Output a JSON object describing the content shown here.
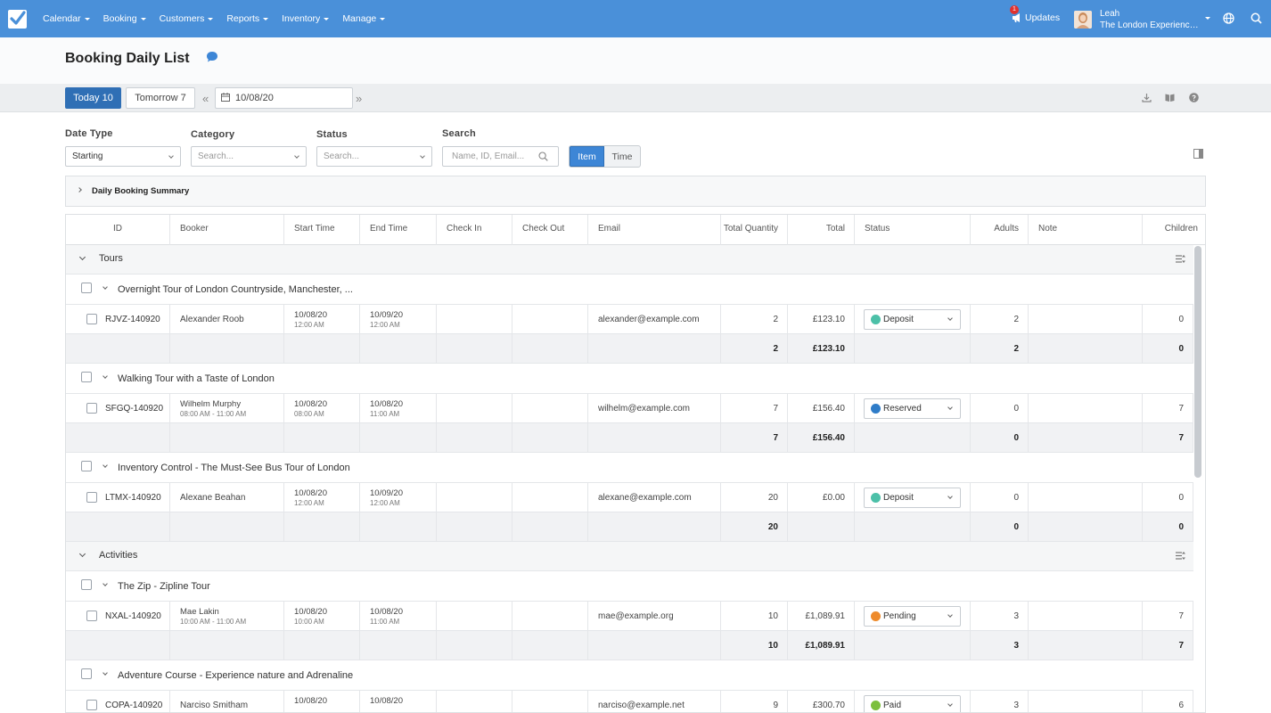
{
  "nav": {
    "items": [
      {
        "label": "Calendar"
      },
      {
        "label": "Booking"
      },
      {
        "label": "Customers"
      },
      {
        "label": "Reports"
      },
      {
        "label": "Inventory"
      },
      {
        "label": "Manage"
      }
    ],
    "updates_label": "Updates",
    "updates_count": "1",
    "user_name": "Leah",
    "user_company": "The London Experience..."
  },
  "page": {
    "title": "Booking Daily List"
  },
  "datebar": {
    "today_label": "Today 10",
    "tomorrow_label": "Tomorrow 7",
    "date_value": "10/08/20"
  },
  "filters": {
    "date_type_label": "Date Type",
    "date_type_value": "Starting",
    "category_label": "Category",
    "category_placeholder": "Search...",
    "status_label": "Status",
    "status_placeholder": "Search...",
    "search_label": "Search",
    "search_placeholder": "Name, ID, Email...",
    "view_item": "Item",
    "view_time": "Time"
  },
  "summary": {
    "label": "Daily Booking Summary"
  },
  "table": {
    "headers": [
      "ID",
      "Booker",
      "Start Time",
      "End Time",
      "Check In",
      "Check Out",
      "Email",
      "Total Quantity",
      "Total",
      "Status",
      "Adults",
      "Note",
      "Children"
    ],
    "categories": [
      {
        "name": "Tours",
        "products": [
          {
            "name": "Overnight Tour of London Countryside, Manchester, ...",
            "booking": {
              "id": "RJVZ-140920",
              "booker": "Alexander Roob",
              "booker_sub": "",
              "start_date": "10/08/20",
              "start_time": "12:00 AM",
              "end_date": "10/09/20",
              "end_time": "12:00 AM",
              "email": "alexander@example.com",
              "qty": "2",
              "total": "£123.10",
              "status": "Deposit",
              "adults": "2",
              "children": "0"
            },
            "totals": {
              "qty": "2",
              "total": "£123.10",
              "adults": "2",
              "children": "0"
            }
          },
          {
            "name": "Walking Tour with a Taste of London",
            "booking": {
              "id": "SFGQ-140920",
              "booker": "Wilhelm Murphy",
              "booker_sub": "08:00 AM - 11:00 AM",
              "start_date": "10/08/20",
              "start_time": "08:00 AM",
              "end_date": "10/08/20",
              "end_time": "11:00 AM",
              "email": "wilhelm@example.com",
              "qty": "7",
              "total": "£156.40",
              "status": "Reserved",
              "adults": "0",
              "children": "7"
            },
            "totals": {
              "qty": "7",
              "total": "£156.40",
              "adults": "0",
              "children": "7"
            }
          },
          {
            "name": "Inventory Control - The Must-See Bus Tour of London",
            "booking": {
              "id": "LTMX-140920",
              "booker": "Alexane Beahan",
              "booker_sub": "",
              "start_date": "10/08/20",
              "start_time": "12:00 AM",
              "end_date": "10/09/20",
              "end_time": "12:00 AM",
              "email": "alexane@example.com",
              "qty": "20",
              "total": "£0.00",
              "status": "Deposit",
              "adults": "0",
              "children": "0"
            },
            "totals": {
              "qty": "20",
              "total": "",
              "adults": "0",
              "children": "0"
            }
          }
        ]
      },
      {
        "name": "Activities",
        "products": [
          {
            "name": "The Zip - Zipline Tour",
            "booking": {
              "id": "NXAL-140920",
              "booker": "Mae Lakin",
              "booker_sub": "10:00 AM - 11:00 AM",
              "start_date": "10/08/20",
              "start_time": "10:00 AM",
              "end_date": "10/08/20",
              "end_time": "11:00 AM",
              "email": "mae@example.org",
              "qty": "10",
              "total": "£1,089.91",
              "status": "Pending",
              "adults": "3",
              "children": "7"
            },
            "totals": {
              "qty": "10",
              "total": "£1,089.91",
              "adults": "3",
              "children": "7"
            }
          },
          {
            "name": "Adventure Course - Experience nature and Adrenaline",
            "booking": {
              "id": "COPA-140920",
              "booker": "Narciso Smitham",
              "booker_sub": "",
              "start_date": "10/08/20",
              "start_time": "",
              "end_date": "10/08/20",
              "end_time": "",
              "email": "narciso@example.net",
              "qty": "9",
              "total": "£300.70",
              "status": "Paid",
              "adults": "3",
              "children": "6"
            }
          }
        ]
      }
    ]
  },
  "status_colors": {
    "Deposit": "#4cc0a8",
    "Reserved": "#2f7cc8",
    "Pending": "#ee8b2c",
    "Paid": "#7bbf3c"
  },
  "colors": {
    "topbar": "#4a90d9",
    "primary_button": "#2f6fb5"
  }
}
